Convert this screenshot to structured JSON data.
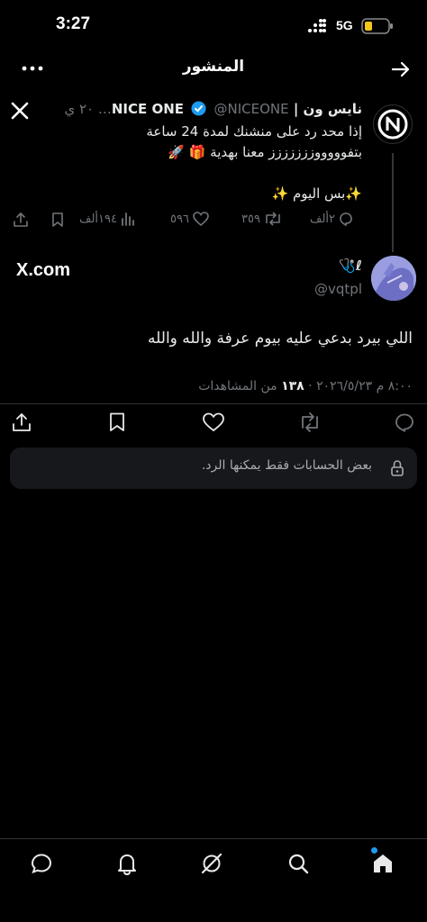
{
  "status_bar": {
    "time": "3:27",
    "network": "5G"
  },
  "header": {
    "title": "المنشور"
  },
  "quoted_post": {
    "author_name": "نايس ون | NICE ONE",
    "handle_time": "@NICEONE… ٢٠ ي",
    "text_lines": [
      "إذا محد رد على منشنك لمدة 24 ساعة",
      "بتفوووووززززززز معنا بهدية 🎁 🚀",
      "",
      "✨بس اليوم ✨"
    ],
    "replies": "٢ألف",
    "reposts": "٣٥٩",
    "likes": "٥٩٦",
    "views": "١٩٤ألف"
  },
  "main_post": {
    "author_name": "ℓ🩺",
    "handle": "@vqtpl",
    "source_label": "X.com",
    "text": "اللي بيرد بدعي عليه بيوم عرفة والله والله",
    "timestamp": "٨:٠٠ م ٢٠٢٦/٥/٢٣ ·",
    "views_count": "١٣٨",
    "views_label": "من المشاهدات"
  },
  "reply_notice": "بعض الحسابات فقط يمكنها الرد.",
  "colors": {
    "background": "#000000",
    "text": "#e7e9ea",
    "muted": "#71767b",
    "verified": "#1d9bf0",
    "notice_bg": "#16181c"
  },
  "bottom_nav": [
    "home-icon",
    "explore-icon",
    "grok-icon",
    "notifications-icon",
    "messages-icon"
  ]
}
